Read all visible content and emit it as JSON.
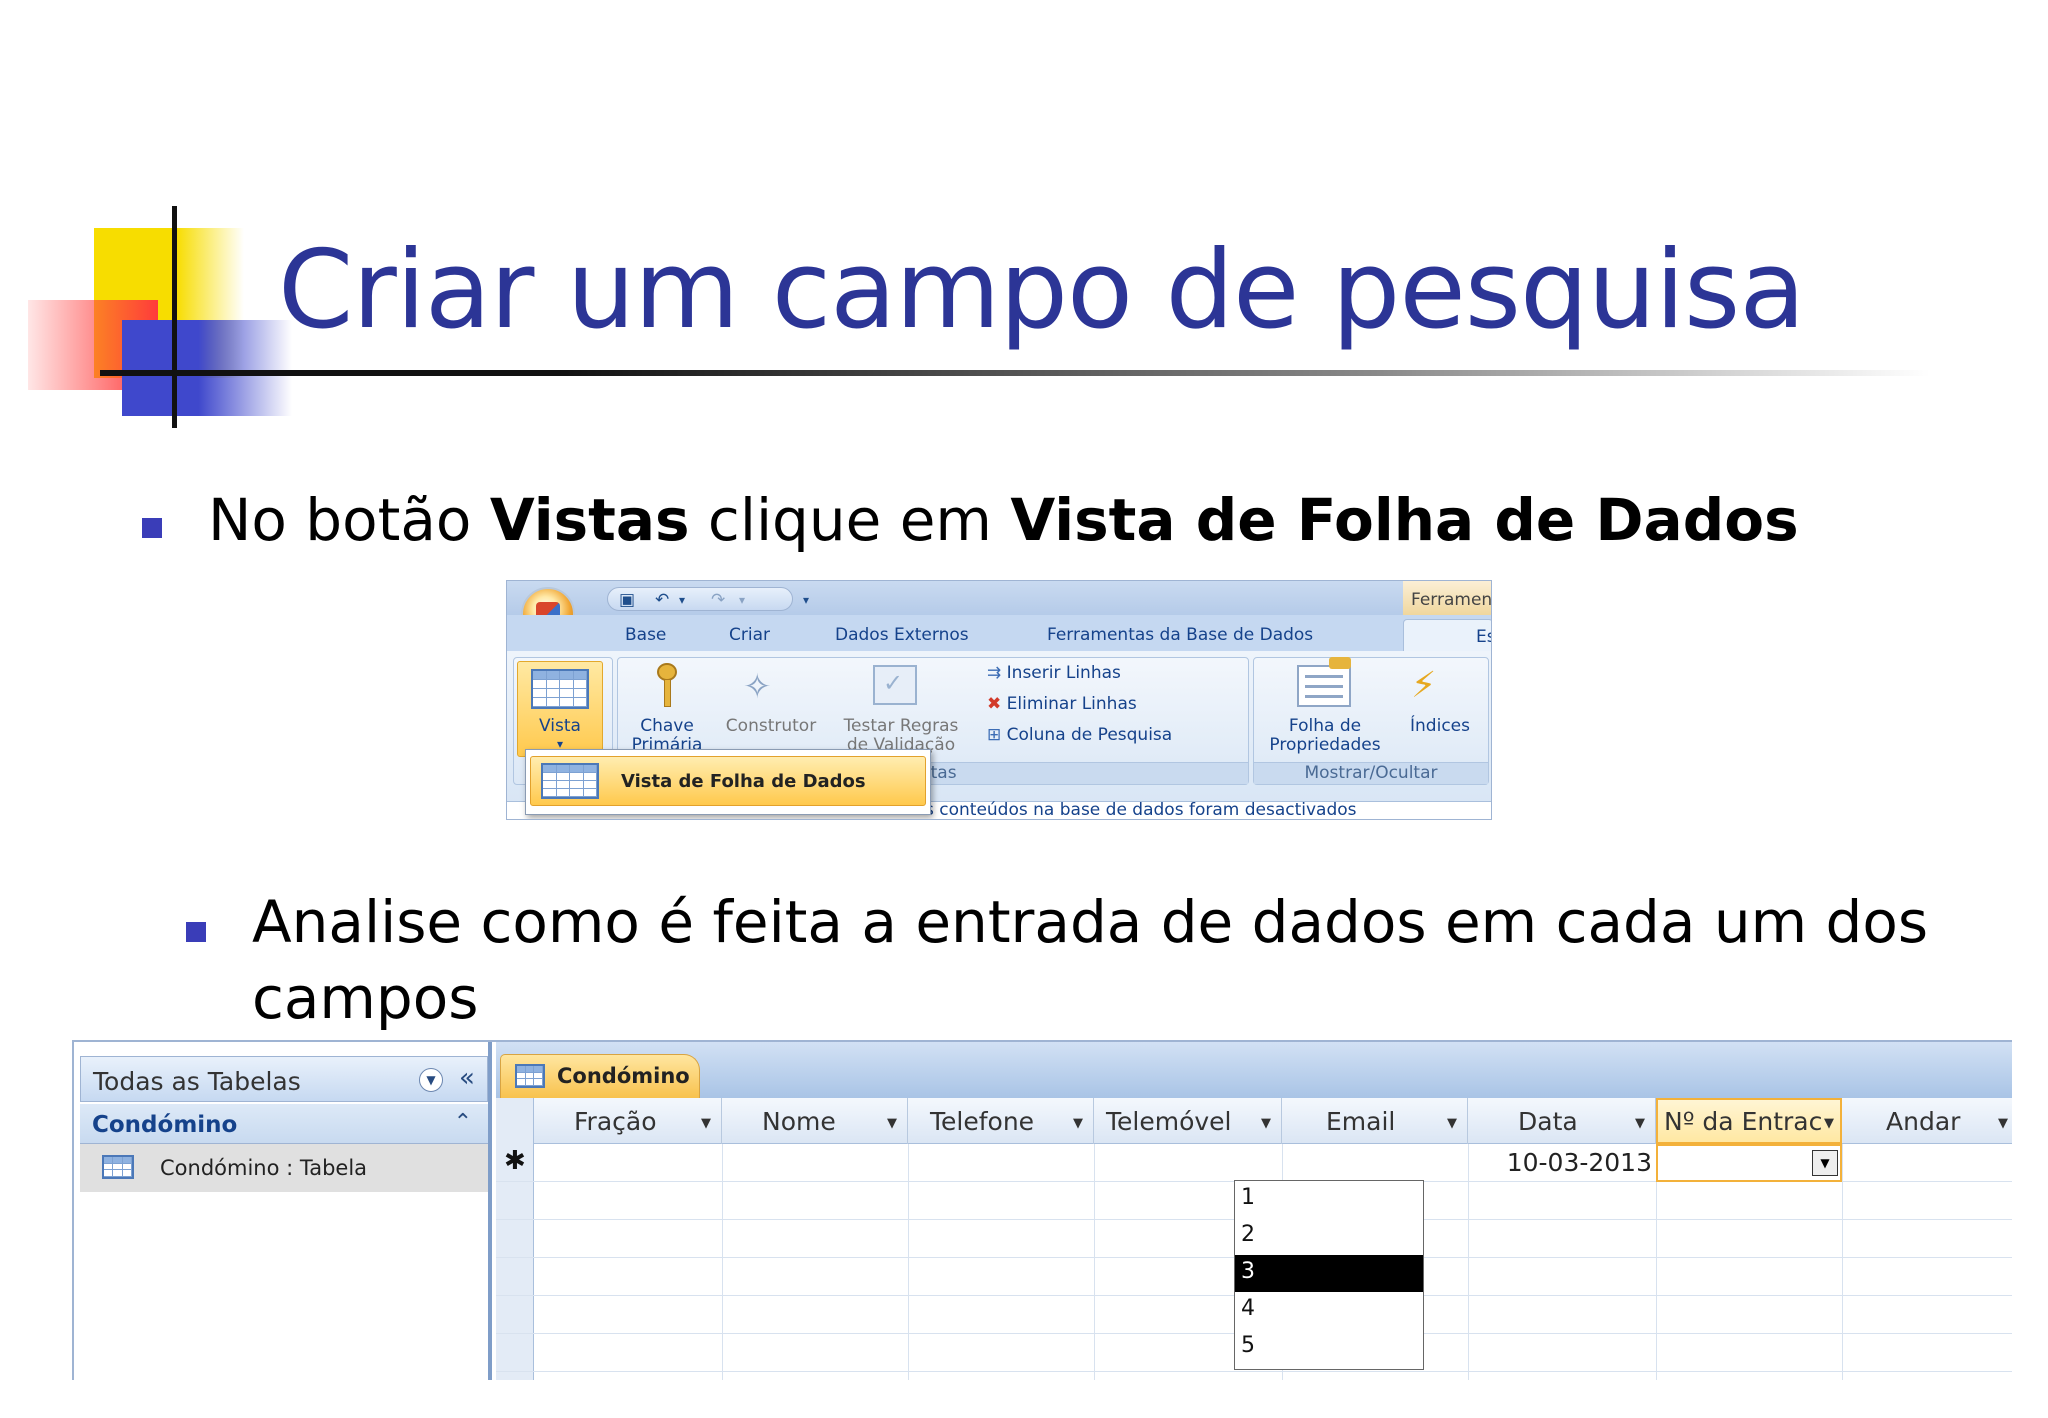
{
  "slide": {
    "title": "Criar um campo de pesquisa",
    "bullet1": {
      "t1": "No botão ",
      "b1": "Vistas",
      "t2": " clique em ",
      "b2": "Vista de Folha de Dados"
    },
    "bullet2": {
      "line1": "Analise como é feita a entrada de dados em cada um dos",
      "line2": "campos"
    },
    "colors": {
      "title": "#2c3596",
      "bullet": "#3a3db8"
    }
  },
  "ribbon": {
    "tools_tab": "Ferramen",
    "tabs": [
      "Base",
      "Criar",
      "Dados Externos",
      "Ferramentas da Base de Dados"
    ],
    "active_tab": "Es",
    "vista": {
      "label": "Vista",
      "icon": "table-grid-icon"
    },
    "tools_group": {
      "chave": {
        "line1": "Chave",
        "line2": "Primária",
        "icon": "key-icon"
      },
      "construtor": {
        "label": "Construtor",
        "icon": "builder-wand-icon"
      },
      "testar": {
        "line1": "Testar Regras",
        "line2": "de Validação",
        "icon": "validation-check-icon"
      },
      "inserir": "Inserir Linhas",
      "eliminar": "Eliminar Linhas",
      "coluna": "Coluna de Pesquisa",
      "group_label": "entas"
    },
    "show_group": {
      "folha": {
        "line1": "Folha de",
        "line2": "Propriedades",
        "icon": "property-sheet-icon"
      },
      "indices": {
        "label": "Índices",
        "icon": "lightning-index-icon"
      },
      "group_label": "Mostrar/Ocultar"
    },
    "dropdown_item": "Vista de Folha de Dados",
    "message_bar": "s conteúdos na base de dados foram desactivados"
  },
  "access": {
    "nav": {
      "header": "Todas as Tabelas",
      "group": "Condómino",
      "item": "Condómino : Tabela"
    },
    "tab": "Condómino",
    "columns": [
      "Fração",
      "Nome",
      "Telefone",
      "Telemóvel",
      "Email",
      "Data",
      "Nº da Entrac",
      "Andar"
    ],
    "new_row": {
      "marker": "✱",
      "data": "10-03-2013"
    },
    "list_options": [
      "1",
      "2",
      "3",
      "4",
      "5"
    ],
    "selected_option": "3"
  }
}
